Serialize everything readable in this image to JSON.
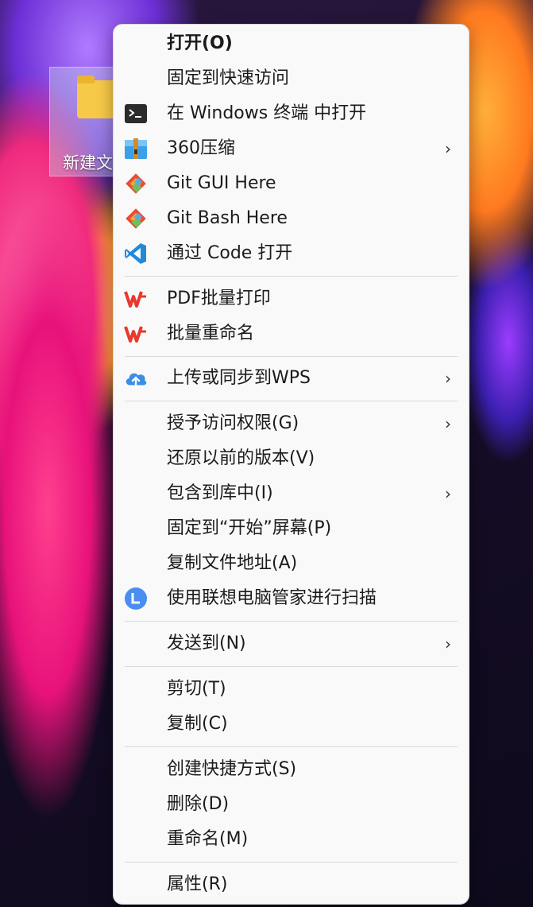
{
  "desktop": {
    "folder_label": "新建文"
  },
  "menu": {
    "items": [
      {
        "label": "打开(O)"
      },
      {
        "label": "固定到快速访问"
      },
      {
        "label": "在 Windows 终端 中打开"
      },
      {
        "label": "360压缩",
        "submenu_arrow": "›"
      },
      {
        "label": "Git GUI Here"
      },
      {
        "label": "Git Bash Here"
      },
      {
        "label": "通过 Code 打开"
      },
      {
        "label": "PDF批量打印"
      },
      {
        "label": "批量重命名"
      },
      {
        "label": "上传或同步到WPS",
        "submenu_arrow": "›"
      },
      {
        "label": "授予访问权限(G)",
        "submenu_arrow": "›"
      },
      {
        "label": "还原以前的版本(V)"
      },
      {
        "label": "包含到库中(I)",
        "submenu_arrow": "›"
      },
      {
        "label": "固定到“开始”屏幕(P)"
      },
      {
        "label": "复制文件地址(A)"
      },
      {
        "label": "使用联想电脑管家进行扫描"
      },
      {
        "label": "发送到(N)",
        "submenu_arrow": "›"
      },
      {
        "label": "剪切(T)"
      },
      {
        "label": "复制(C)"
      },
      {
        "label": "创建快捷方式(S)"
      },
      {
        "label": "删除(D)"
      },
      {
        "label": "重命名(M)"
      },
      {
        "label": "属性(R)"
      }
    ],
    "icons": {
      "terminal": "terminal-icon",
      "zip360": "archive-360-icon",
      "git": "git-icon",
      "vscode": "vscode-icon",
      "wps": "wps-icon",
      "wps_cloud": "cloud-upload-icon",
      "lenovo": "lenovo-manager-icon"
    },
    "colors": {
      "background": "#f9f9f9",
      "text": "#1b1b1b",
      "wps_red": "#e8382f",
      "vscode_blue": "#1f8ad8",
      "cloud_blue": "#3a8ee6",
      "lenovo_blue": "#4a8df0"
    }
  }
}
